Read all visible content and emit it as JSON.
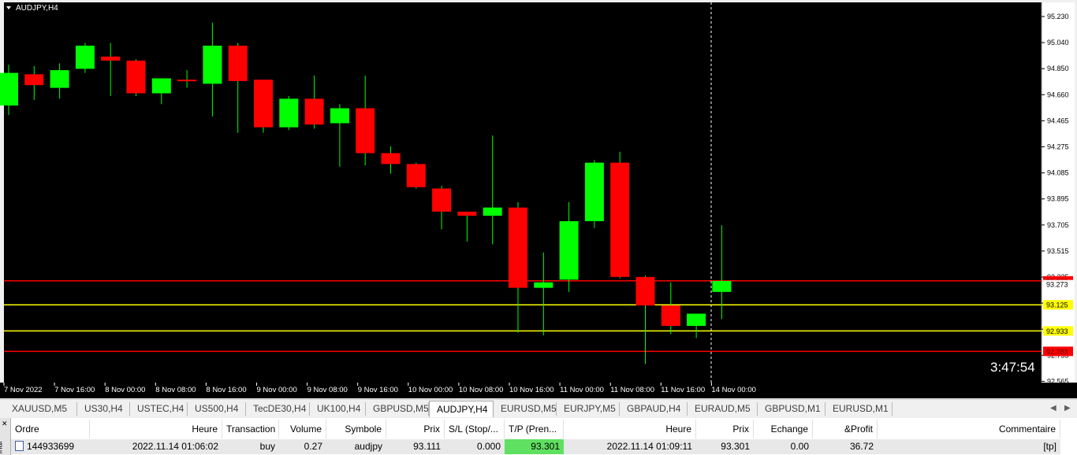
{
  "chart_title": "AUDJPY,H4",
  "countdown": "3:47:54",
  "colors": {
    "bull": "#00ff00",
    "bear": "#ff0000",
    "background": "#000000",
    "wick": "#00ff00",
    "red_level": "#ff0000",
    "yellow_level": "#ffff00"
  },
  "chart_data": {
    "type": "candlestick",
    "symbol": "AUDJPY",
    "timeframe": "H4",
    "ylim": [
      92.565,
      95.25
    ],
    "y_ticks": [
      "95.230",
      "95.040",
      "94.850",
      "94.660",
      "94.465",
      "94.275",
      "94.085",
      "93.895",
      "93.705",
      "93.515",
      "93.325",
      "93.125",
      "92.933",
      "92.735",
      "92.565"
    ],
    "x_ticks": [
      "7 Nov 2022",
      "7 Nov 16:00",
      "8 Nov 00:00",
      "8 Nov 08:00",
      "8 Nov 16:00",
      "9 Nov 00:00",
      "9 Nov 08:00",
      "9 Nov 16:00",
      "10 Nov 00:00",
      "10 Nov 08:00",
      "10 Nov 16:00",
      "11 Nov 00:00",
      "11 Nov 08:00",
      "11 Nov 16:00",
      "14 Nov 00:00"
    ],
    "candles": [
      {
        "o": 94.59,
        "h": 94.89,
        "l": 94.52,
        "c": 94.83
      },
      {
        "o": 94.82,
        "h": 94.88,
        "l": 94.63,
        "c": 94.74
      },
      {
        "o": 94.72,
        "h": 94.9,
        "l": 94.64,
        "c": 94.85
      },
      {
        "o": 94.86,
        "h": 95.05,
        "l": 94.83,
        "c": 95.03
      },
      {
        "o": 94.95,
        "h": 95.05,
        "l": 94.66,
        "c": 94.92
      },
      {
        "o": 94.92,
        "h": 94.93,
        "l": 94.66,
        "c": 94.68
      },
      {
        "o": 94.68,
        "h": 94.78,
        "l": 94.6,
        "c": 94.79
      },
      {
        "o": 94.78,
        "h": 94.85,
        "l": 94.72,
        "c": 94.77
      },
      {
        "o": 94.75,
        "h": 95.2,
        "l": 94.51,
        "c": 95.03
      },
      {
        "o": 95.03,
        "h": 95.05,
        "l": 94.39,
        "c": 94.77
      },
      {
        "o": 94.78,
        "h": 94.78,
        "l": 94.39,
        "c": 94.43
      },
      {
        "o": 94.43,
        "h": 94.66,
        "l": 94.41,
        "c": 94.64
      },
      {
        "o": 94.64,
        "h": 94.81,
        "l": 94.42,
        "c": 94.45
      },
      {
        "o": 94.46,
        "h": 94.6,
        "l": 94.14,
        "c": 94.57
      },
      {
        "o": 94.57,
        "h": 94.81,
        "l": 94.15,
        "c": 94.24
      },
      {
        "o": 94.24,
        "h": 94.29,
        "l": 94.09,
        "c": 94.16
      },
      {
        "o": 94.16,
        "h": 94.17,
        "l": 93.98,
        "c": 93.99
      },
      {
        "o": 93.98,
        "h": 94.0,
        "l": 93.68,
        "c": 93.81
      },
      {
        "o": 93.81,
        "h": 93.81,
        "l": 93.59,
        "c": 93.78
      },
      {
        "o": 93.78,
        "h": 94.37,
        "l": 93.57,
        "c": 93.84
      },
      {
        "o": 93.84,
        "h": 93.88,
        "l": 92.92,
        "c": 93.25
      },
      {
        "o": 93.25,
        "h": 93.51,
        "l": 92.9,
        "c": 93.29
      },
      {
        "o": 93.31,
        "h": 93.88,
        "l": 93.22,
        "c": 93.74
      },
      {
        "o": 93.74,
        "h": 94.19,
        "l": 93.69,
        "c": 94.17
      },
      {
        "o": 94.17,
        "h": 94.25,
        "l": 93.32,
        "c": 93.33
      },
      {
        "o": 93.33,
        "h": 93.34,
        "l": 92.69,
        "c": 93.12
      },
      {
        "o": 93.12,
        "h": 93.29,
        "l": 92.91,
        "c": 92.97
      },
      {
        "o": 92.97,
        "h": 93.06,
        "l": 92.88,
        "c": 93.06
      },
      {
        "o": 93.22,
        "h": 93.71,
        "l": 93.02,
        "c": 93.3
      }
    ],
    "levels": [
      {
        "price": 93.301,
        "label": "93.301",
        "color": "#ff0000"
      },
      {
        "price": 93.125,
        "label": "93.125",
        "color": "#ffff00"
      },
      {
        "price": 92.933,
        "label": "92.933",
        "color": "#ffff00"
      },
      {
        "price": 92.783,
        "label": "92.783",
        "color": "#ff0000"
      }
    ],
    "bid_label": "93.273"
  },
  "tabs": [
    {
      "label": "XAUUSD,M5"
    },
    {
      "label": "US30,H4"
    },
    {
      "label": "USTEC,H4"
    },
    {
      "label": "US500,H4"
    },
    {
      "label": "TecDE30,H4"
    },
    {
      "label": "UK100,H4"
    },
    {
      "label": "GBPUSD,M5"
    },
    {
      "label": "AUDJPY,H4"
    },
    {
      "label": "EURUSD,M5"
    },
    {
      "label": "EURJPY,M5"
    },
    {
      "label": "GBPAUD,H4"
    },
    {
      "label": "EURAUD,M5"
    },
    {
      "label": "GBPUSD,M1"
    },
    {
      "label": "EURUSD,M1"
    }
  ],
  "active_tab": "AUDJPY,H4",
  "terminal": {
    "side_label": "inal",
    "headers": [
      "Ordre",
      "Heure",
      "Transaction",
      "Volume",
      "Symbole",
      "Prix",
      "S/L (Stop/...",
      "T/P (Pren...",
      "Heure",
      "Prix",
      "Echange",
      "&Profit",
      "Commentaire"
    ],
    "row": {
      "ordre": "144933699",
      "heure_open": "2022.11.14 01:06:02",
      "transaction": "buy",
      "volume": "0.27",
      "symbole": "audjpy",
      "prix_open": "93.111",
      "sl": "0.000",
      "tp": "93.301",
      "heure_close": "2022.11.14 01:09:11",
      "prix_close": "93.301",
      "echange": "0.00",
      "profit": "36.72",
      "commentaire": "[tp]"
    }
  }
}
